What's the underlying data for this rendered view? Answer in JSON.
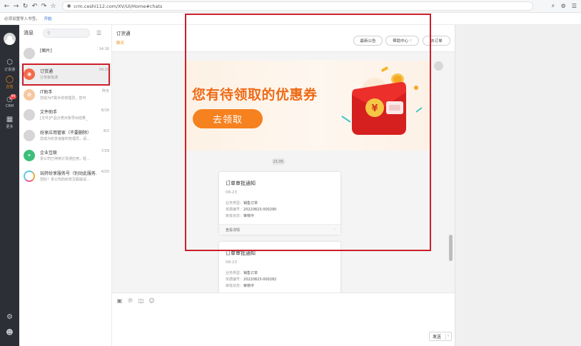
{
  "browser": {
    "url": "crm.ceshi112.com/XV/UI/Home#chats",
    "bookmarks_hint": "必须设置导入书签。",
    "bookmarks_link": "开始"
  },
  "nav": {
    "items": [
      {
        "label": "订货通",
        "icon": "cube-icon"
      },
      {
        "label": "企信",
        "icon": "chat-bubble-icon",
        "active": true
      },
      {
        "label": "CRM",
        "icon": "crm-icon",
        "badge": "99"
      },
      {
        "label": "更多",
        "icon": "grid-icon"
      }
    ]
  },
  "conversations": {
    "title": "消息",
    "items": [
      {
        "name": "[图片]",
        "snippet": "",
        "time": "14:16"
      },
      {
        "name": "订货通",
        "snippet": "订单审批通",
        "time": "09:10"
      },
      {
        "name": "IT助手",
        "snippet": "您成为IT助手的管理员，您可",
        "time": "昨天"
      },
      {
        "name": "文件助手",
        "snippet": "[文件]产品分类对象导出结果_",
        "time": "8/16"
      },
      {
        "name": "纷享应用管家（不要删除）",
        "snippet": "您成为纷享逍客的管理员，请…",
        "time": "8/2"
      },
      {
        "name": "企业互联",
        "snippet": "贵公司已停用订货通应用，轻…",
        "time": "7/29"
      },
      {
        "name": "玩转纷享服务号（别动此服务…",
        "snippet": "您好！贵公司的纷享互联版试…",
        "time": "4/20"
      }
    ]
  },
  "chat": {
    "name": "订货通",
    "tab": "聊天",
    "buttons": {
      "announcement": "最新公告",
      "help": "帮助中心",
      "order": "去订单"
    },
    "banner": {
      "title": "您有待领取的优惠券",
      "button": "去领取"
    },
    "time_label": "21:05",
    "cards": [
      {
        "title": "订单审批通知",
        "date": "08-23",
        "business_type_label": "业务类型：",
        "business_type": "销售订单",
        "order_no_label": "单据编号：",
        "order_no": "20220823-000290",
        "status_label": "审批状态：",
        "status": "审核中",
        "footer": "查看详情"
      },
      {
        "title": "订单审批通知",
        "date": "08-23",
        "business_type_label": "业务类型：",
        "business_type": "销售订单",
        "order_no_label": "单据编号：",
        "order_no": "20220823-000282",
        "status_label": "审批状态：",
        "status": "审核中"
      }
    ],
    "send_label": "发送"
  },
  "colors": {
    "accent": "#f08c1a",
    "nav_bg": "#2c2f36",
    "highlight": "#cc1f2b"
  }
}
